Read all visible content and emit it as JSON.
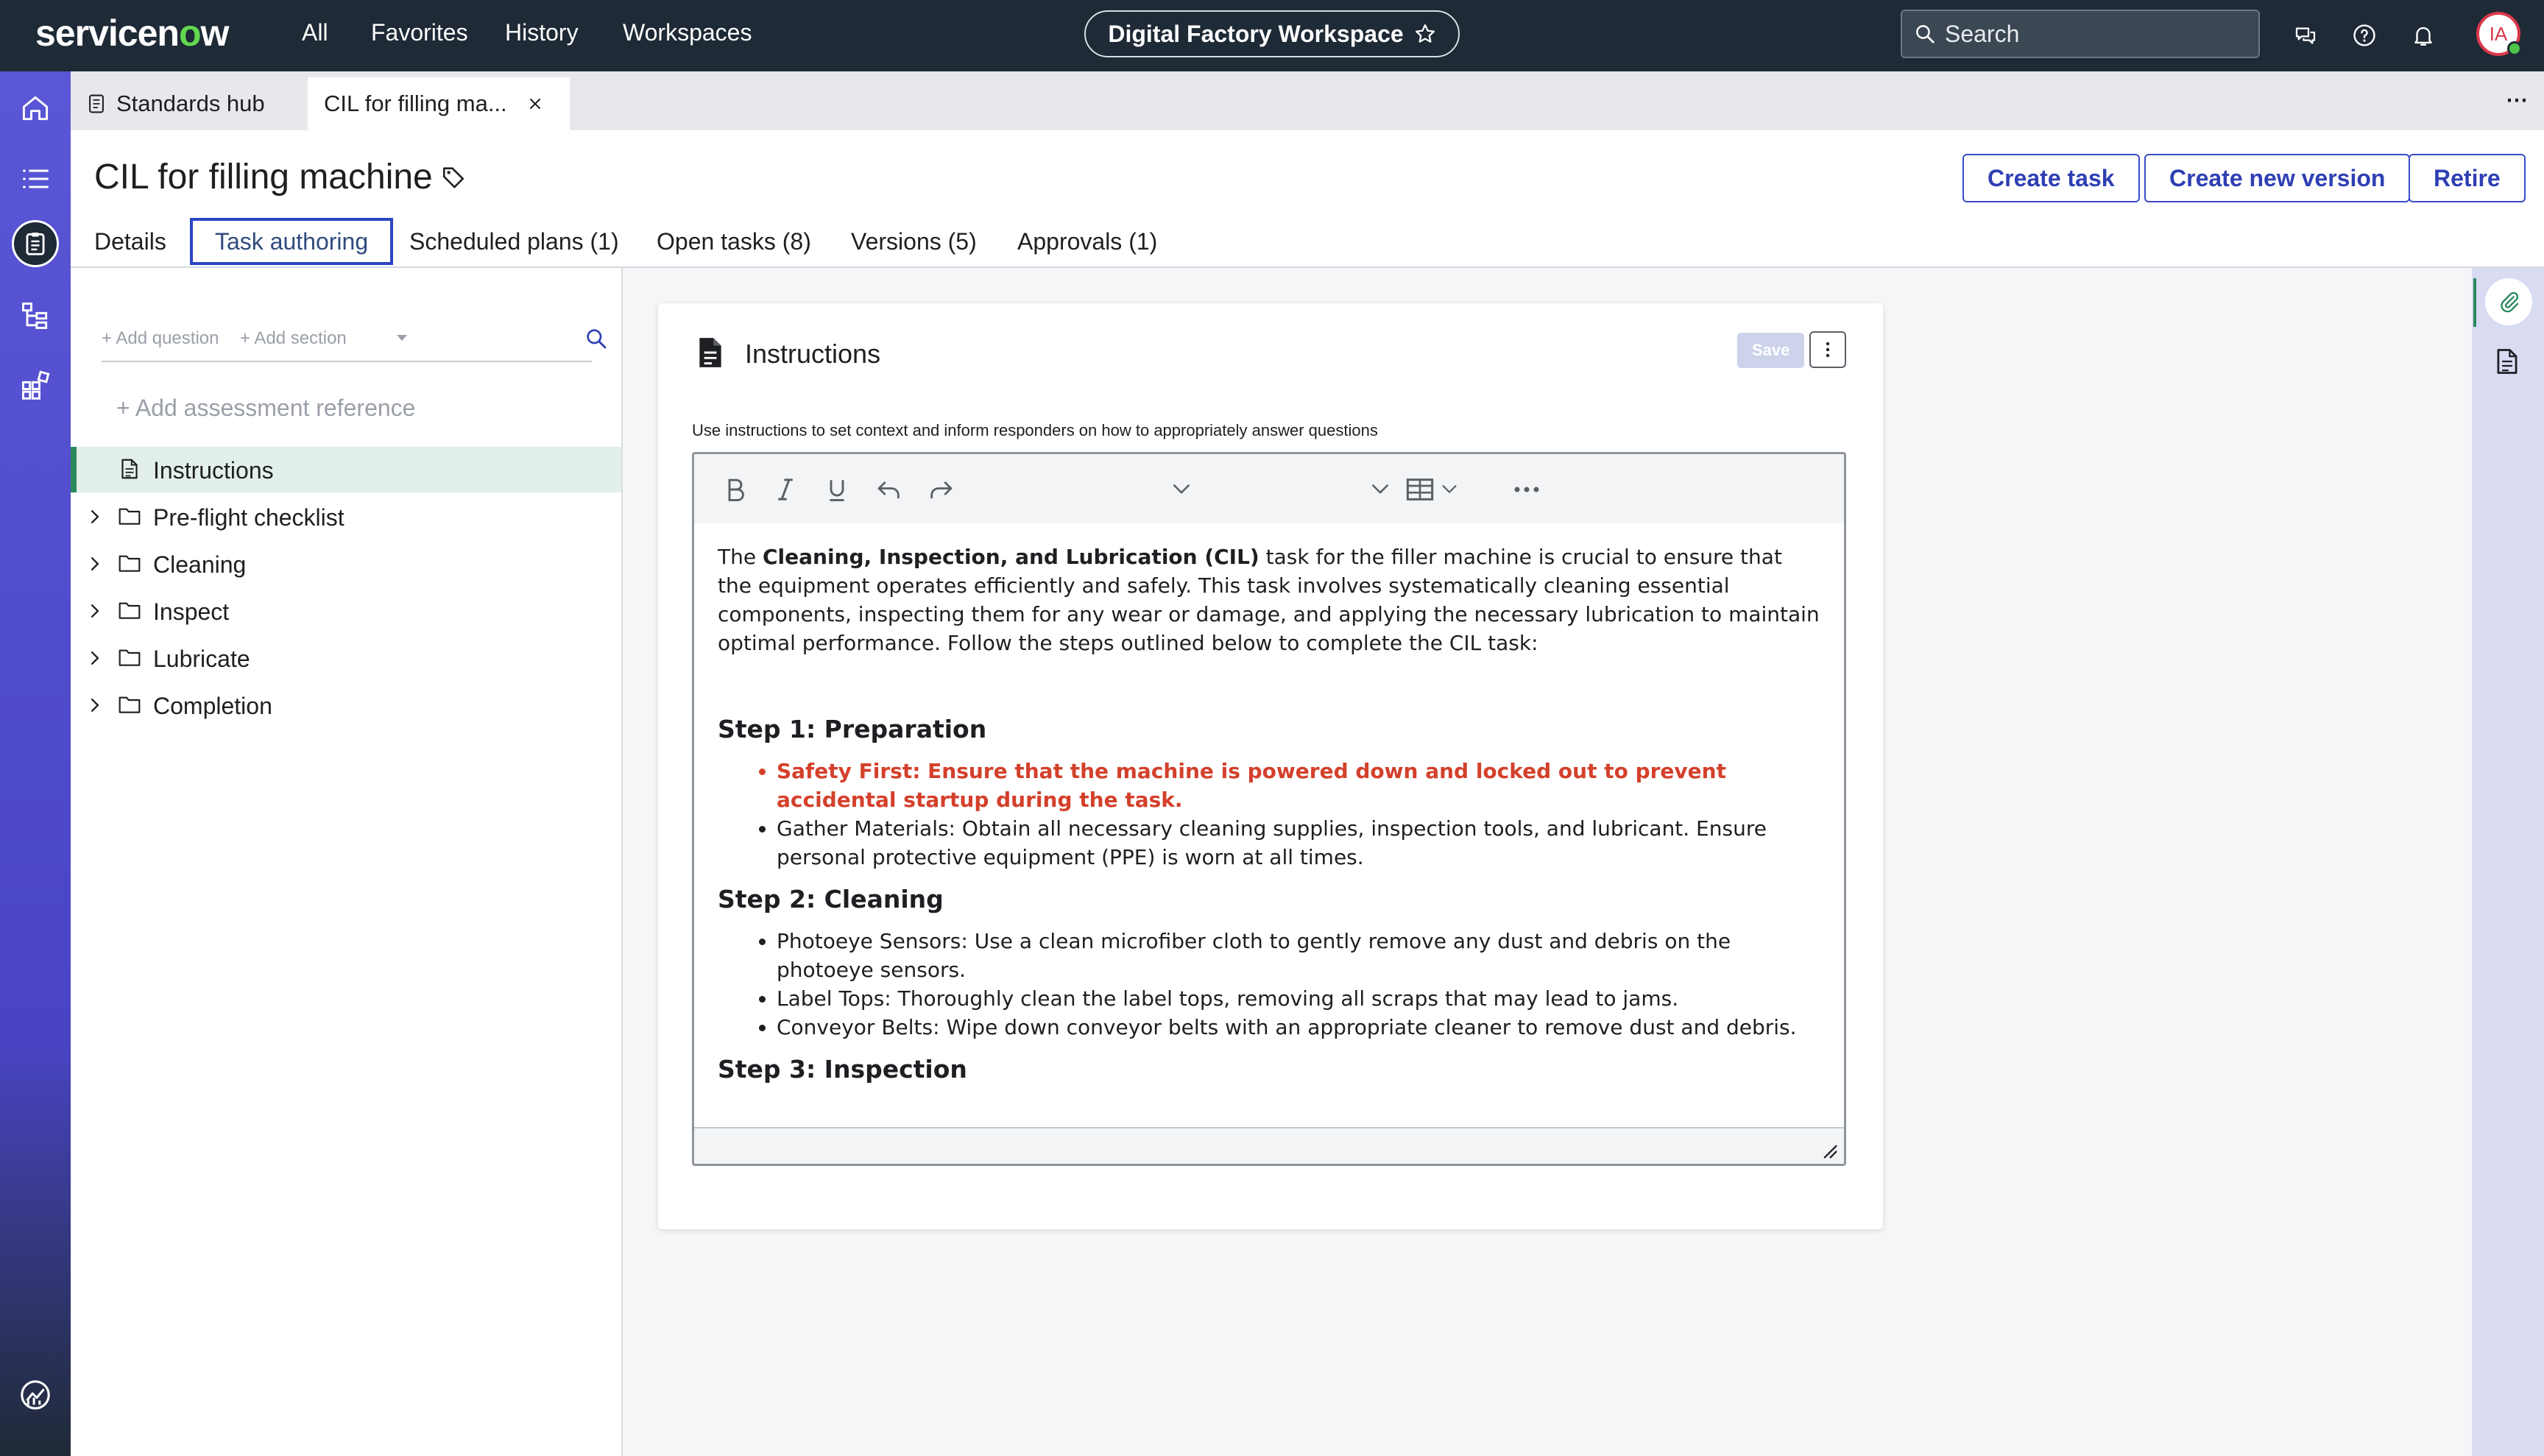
{
  "topbar": {
    "logo_text": "servicenow",
    "nav": [
      "All",
      "Favorites",
      "History",
      "Workspaces"
    ],
    "workspace_name": "Digital Factory Workspace",
    "search_placeholder": "Search",
    "avatar_initials": "IA"
  },
  "tabs": {
    "hub_label": "Standards hub",
    "record_label": "CIL for filling ma...",
    "more": "⋯"
  },
  "header": {
    "title": "CIL for filling machine",
    "buttons": {
      "create_task": "Create task",
      "create_version": "Create new version",
      "retire": "Retire"
    },
    "subtabs": [
      "Details",
      "Task authoring",
      "Scheduled plans (1)",
      "Open tasks (8)",
      "Versions (5)",
      "Approvals (1)"
    ],
    "active_subtab": "Task authoring"
  },
  "authoring": {
    "add_question": "+ Add question",
    "add_section": "+ Add section",
    "add_reference": "+ Add assessment reference",
    "tree": [
      {
        "label": "Instructions",
        "type": "document",
        "selected": true
      },
      {
        "label": "Pre-flight checklist",
        "type": "folder"
      },
      {
        "label": "Cleaning",
        "type": "folder"
      },
      {
        "label": "Inspect",
        "type": "folder"
      },
      {
        "label": "Lubricate",
        "type": "folder"
      },
      {
        "label": "Completion",
        "type": "folder"
      }
    ]
  },
  "card": {
    "title": "Instructions",
    "save_label": "Save",
    "hint": "Use instructions to set context and inform responders on how to appropriately answer questions",
    "body": {
      "intro_before": "The ",
      "intro_bold": "Cleaning, Inspection, and Lubrication (CIL)",
      "intro_after": " task for the filler machine is crucial to ensure that the equipment operates efficiently and safely. This task involves systematically cleaning essential components, inspecting them for any wear or damage, and applying the necessary lubrication to maintain optimal performance. Follow the steps outlined below to complete the CIL task:",
      "step1_heading": "Step 1: Preparation",
      "step1_items": [
        "Safety First: Ensure that the machine is powered down and locked out to prevent accidental startup during the task.",
        "Gather Materials: Obtain all necessary cleaning supplies, inspection tools, and lubricant. Ensure personal protective equipment (PPE) is worn at all times."
      ],
      "step2_heading": "Step 2: Cleaning",
      "step2_items": [
        "Photoeye Sensors: Use a clean microfiber cloth to gently remove any dust and debris on the photoeye sensors.",
        "Label Tops: Thoroughly clean the label tops, removing all scraps that may lead to jams.",
        "Conveyor Belts: Wipe down conveyor belts with an appropriate cleaner to remove dust and debris."
      ],
      "step3_heading": "Step 3: Inspection"
    }
  },
  "colors": {
    "topbar": "#1e2a36",
    "rail": "#5a57d6",
    "primary": "#2f3fb3",
    "selected_row": "#e2efea",
    "safety_red": "#d4402b"
  },
  "icons": {
    "rail": [
      "home-icon",
      "list-icon",
      "clipboard-icon",
      "hierarchy-icon",
      "apps-icon",
      "analytics-icon"
    ],
    "topbar": [
      "chat-icon",
      "help-icon",
      "bell-icon"
    ]
  }
}
